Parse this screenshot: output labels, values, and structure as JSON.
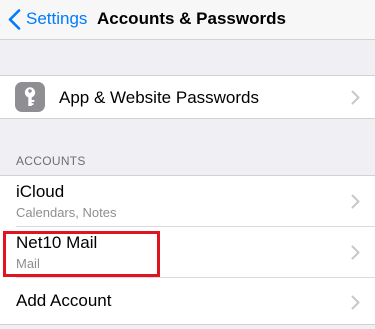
{
  "navbar": {
    "back_label": "Settings",
    "title": "Accounts & Passwords",
    "back_icon": "chevron-left-icon"
  },
  "passwords": {
    "label": "App & Website Passwords",
    "icon": "key-icon"
  },
  "accounts": {
    "header": "ACCOUNTS",
    "items": [
      {
        "title": "iCloud",
        "subtitle": "Calendars, Notes"
      },
      {
        "title": "Net10 Mail",
        "subtitle": "Mail"
      }
    ],
    "add_label": "Add Account"
  },
  "colors": {
    "accent": "#007aff",
    "highlight": "#e0141e",
    "background": "#efeff4"
  }
}
